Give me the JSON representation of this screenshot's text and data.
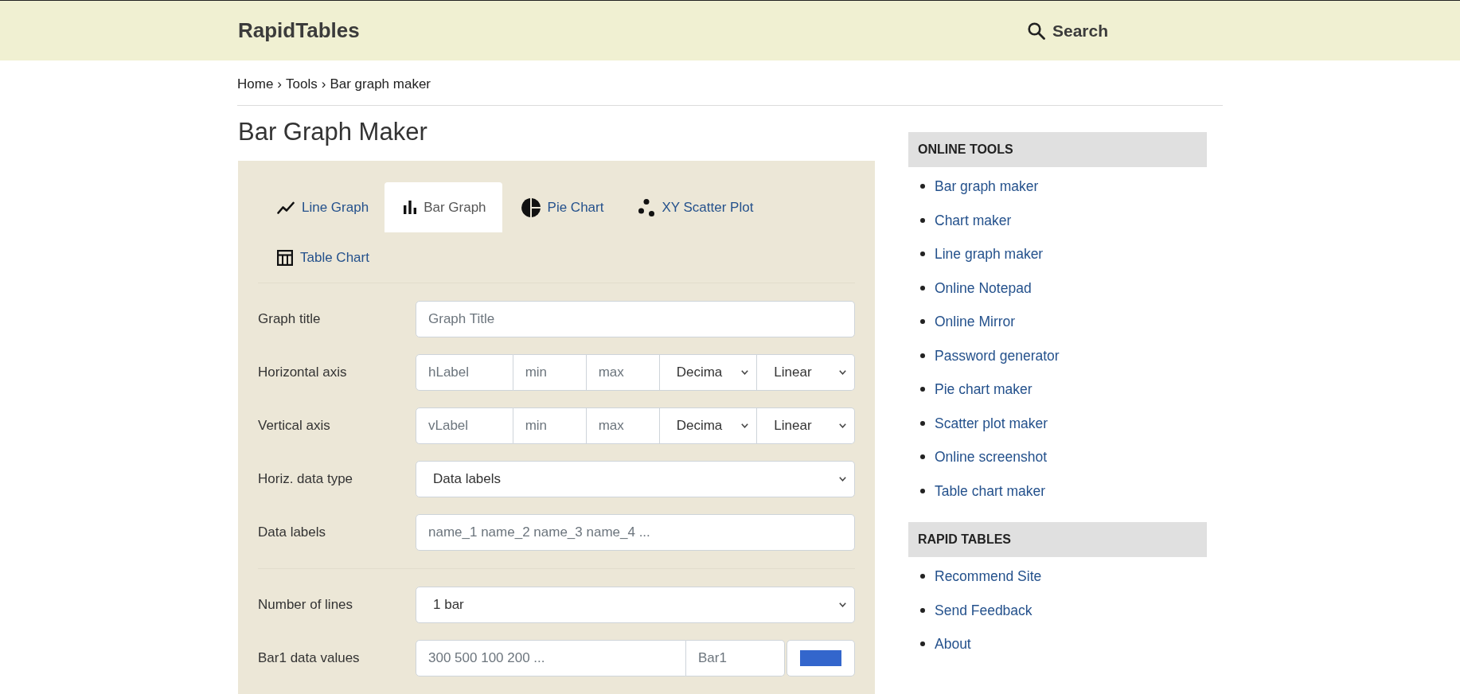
{
  "header": {
    "logo": "RapidTables",
    "search": "Search"
  },
  "breadcrumb": [
    {
      "kind": "link",
      "text": "Home"
    },
    {
      "kind": "separator",
      "text": "›"
    },
    {
      "kind": "link",
      "text": "Tools"
    },
    {
      "kind": "separator",
      "text": "›"
    },
    {
      "kind": "current",
      "text": "Bar graph maker"
    }
  ],
  "title": "Bar Graph Maker",
  "tabs": [
    {
      "kind": "line",
      "label": "Line Graph",
      "selected": false
    },
    {
      "kind": "bar",
      "label": "Bar Graph",
      "selected": true
    },
    {
      "kind": "pie",
      "label": "Pie Chart",
      "selected": false
    },
    {
      "kind": "scatter",
      "label": "XY Scatter Plot",
      "selected": false
    },
    {
      "kind": "table",
      "label": "Table Chart",
      "selected": false
    }
  ],
  "form": {
    "sections": [
      {
        "rows": [
          {
            "label": "Graph title",
            "fields": [
              {
                "kind": "input",
                "placeholder": "Graph Title"
              }
            ]
          },
          {
            "label": "Horizontal axis",
            "fields": [
              {
                "kind": "input",
                "placeholder": "hLabel"
              },
              {
                "kind": "input",
                "placeholder": "min"
              },
              {
                "kind": "input",
                "placeholder": "max"
              },
              {
                "kind": "select",
                "value": "Decima"
              },
              {
                "kind": "select",
                "value": "Linear"
              }
            ]
          },
          {
            "label": "Vertical axis",
            "fields": [
              {
                "kind": "input",
                "placeholder": "vLabel"
              },
              {
                "kind": "input",
                "placeholder": "min"
              },
              {
                "kind": "input",
                "placeholder": "max"
              },
              {
                "kind": "select",
                "value": "Decima"
              },
              {
                "kind": "select",
                "value": "Linear"
              }
            ]
          },
          {
            "label": "Horiz. data type",
            "fields": [
              {
                "kind": "select",
                "value": "Data labels"
              }
            ]
          },
          {
            "label": "Data labels",
            "fields": [
              {
                "kind": "input",
                "placeholder": "name_1 name_2 name_3 name_4 ..."
              }
            ]
          }
        ]
      },
      {
        "rows": [
          {
            "label": "Number of lines",
            "fields": [
              {
                "kind": "select",
                "value": "1 bar"
              }
            ]
          },
          {
            "label": "Bar1 data values",
            "fields": [
              {
                "kind": "input",
                "placeholder": "300 500 100 200 ..."
              },
              {
                "kind": "input",
                "placeholder": "Bar1"
              },
              {
                "kind": "color",
                "color": "#3366cc"
              }
            ]
          }
        ]
      }
    ]
  },
  "sidebar": [
    {
      "title": "ONLINE TOOLS",
      "links": [
        "Bar graph maker",
        "Chart maker",
        "Line graph maker",
        "Online Notepad",
        "Online Mirror",
        "Password generator",
        "Pie chart maker",
        "Scatter plot maker",
        "Online screenshot",
        "Table chart maker"
      ]
    },
    {
      "title": "RAPID TABLES",
      "links": [
        "Recommend Site",
        "Send Feedback",
        "About"
      ]
    }
  ]
}
